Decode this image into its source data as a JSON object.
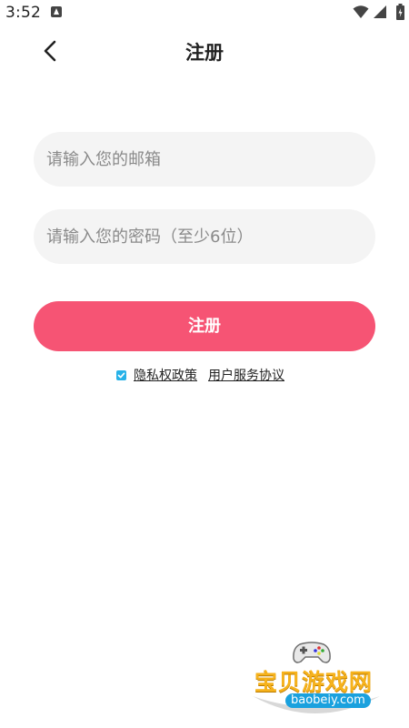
{
  "status_bar": {
    "time": "3:52"
  },
  "header": {
    "title": "注册",
    "back_icon": "chevron-left-icon"
  },
  "form": {
    "email_placeholder": "请输入您的邮箱",
    "email_value": "",
    "password_placeholder": "请输入您的密码（至少6位）",
    "password_value": "",
    "register_label": "注册",
    "agreement": {
      "checked": true,
      "privacy_label": "隐私权政策",
      "terms_label": "用户服务协议"
    }
  },
  "watermark": {
    "name": "宝贝游戏网",
    "domain": "baobeiy.com"
  },
  "colors": {
    "primary": "#f65474",
    "input_bg": "#f4f4f4",
    "checkbox": "#27b2e8"
  }
}
